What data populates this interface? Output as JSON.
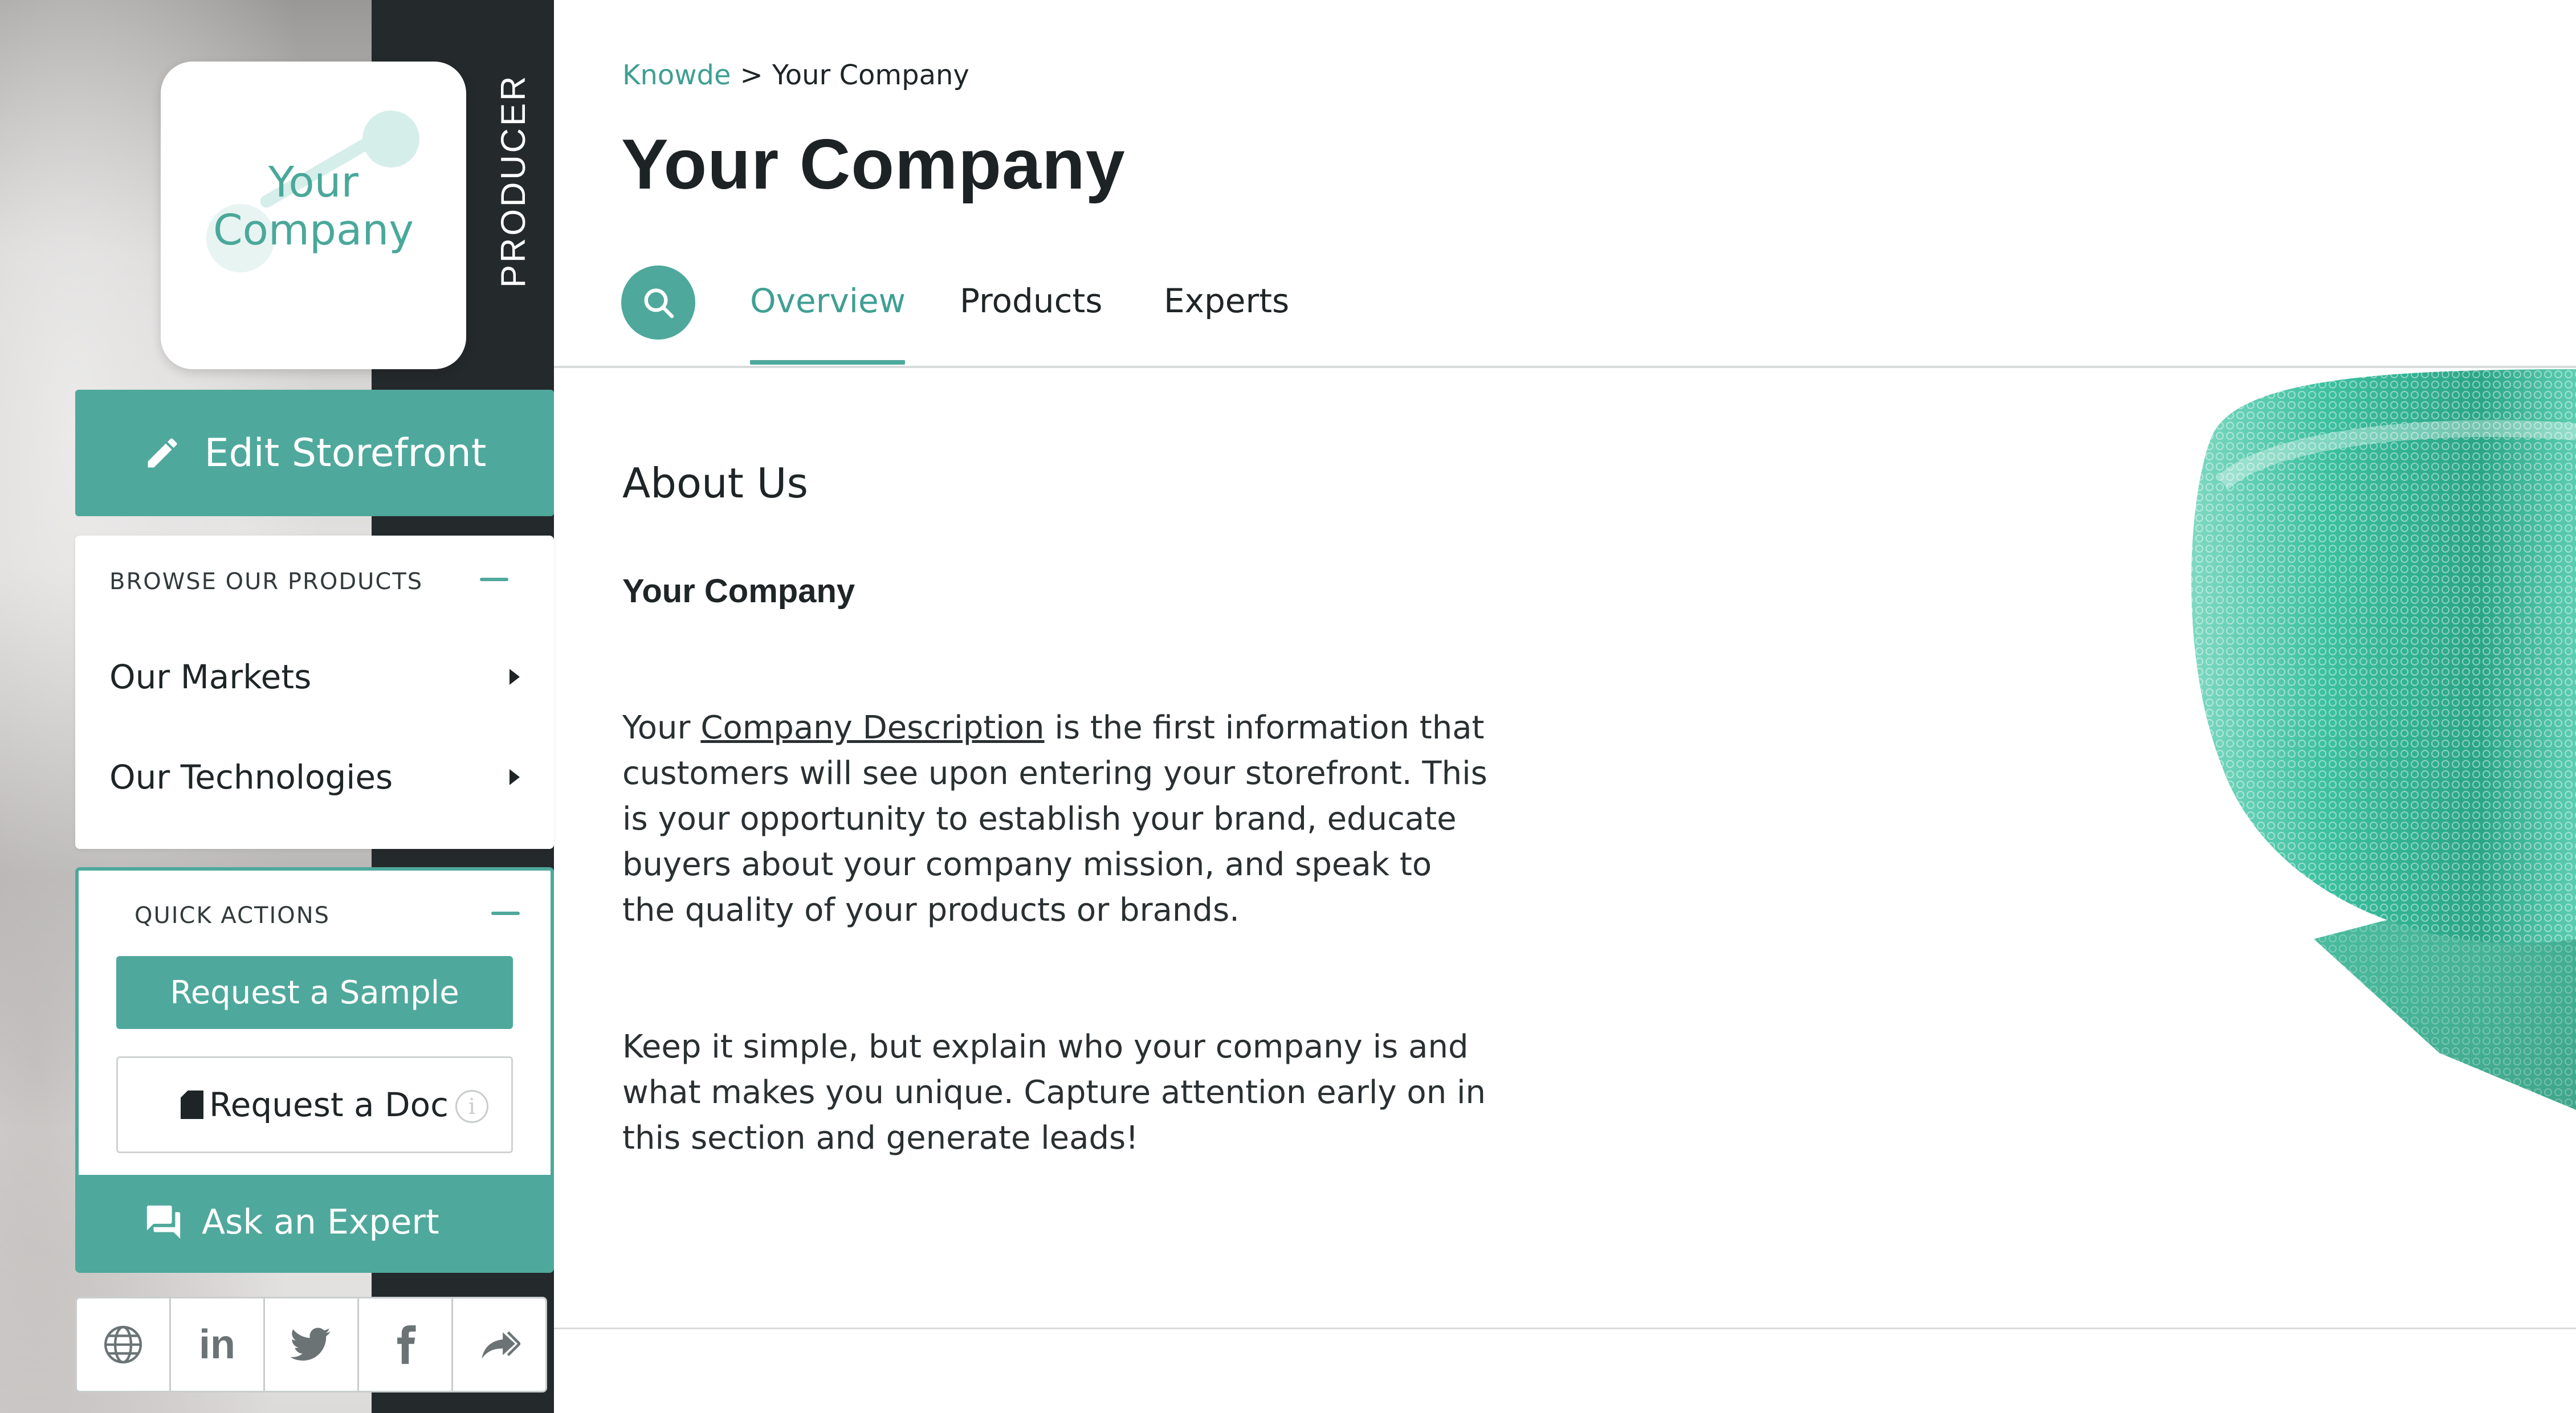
{
  "brand": {
    "logo_line1": "Your",
    "logo_line2": "Company",
    "badge": "PRODUCER",
    "accent": "#4fa89c"
  },
  "sidebar": {
    "edit_storefront": "Edit Storefront",
    "browse": {
      "title": "BROWSE OUR PRODUCTS",
      "items": [
        {
          "label": "Our Markets"
        },
        {
          "label": "Our Technologies"
        }
      ]
    },
    "quick_actions": {
      "title": "QUICK ACTIONS",
      "request_sample": "Request a Sample",
      "request_doc": "Request a Doc",
      "info": "i",
      "ask_expert": "Ask an Expert"
    },
    "social": [
      "globe-icon",
      "linkedin-icon",
      "twitter-icon",
      "facebook-icon",
      "share-icon"
    ],
    "linkedin_label": "in"
  },
  "header": {
    "breadcrumb": {
      "root": "Knowde",
      "separator": ">",
      "current": "Your Company"
    },
    "title": "Your Company",
    "tabs": [
      {
        "label": "Overview",
        "active": true
      },
      {
        "label": "Products",
        "active": false
      },
      {
        "label": "Experts",
        "active": false
      }
    ]
  },
  "main": {
    "section_title": "About Us",
    "company_name": "Your Company",
    "para1": {
      "pre": "Your ",
      "link": "Company Description",
      "post": " is the first information that customers will see upon entering your storefront. This is your opportunity to establish your brand, educate buyers about your company mission, and speak to the quality of your products or brands."
    },
    "para2": "Keep it simple, but explain who your company is and what makes you unique. Capture attention early on in this section and generate leads!"
  }
}
